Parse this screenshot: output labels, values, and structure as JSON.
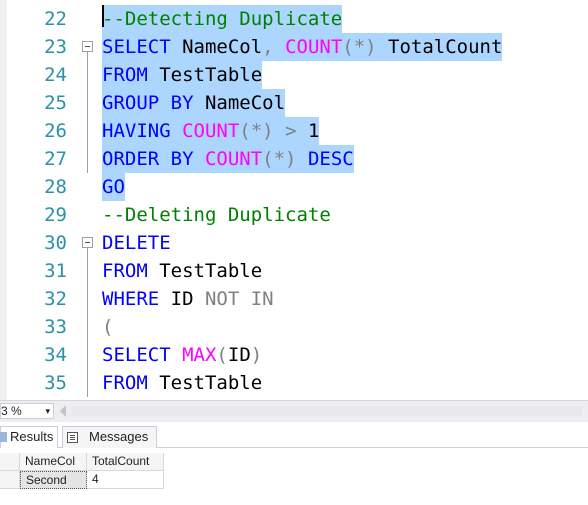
{
  "editor": {
    "lines": [
      {
        "num": "22",
        "sel": true,
        "fold": "",
        "tokens": [
          {
            "t": "--Detecting Duplicate",
            "c": "cm"
          }
        ]
      },
      {
        "num": "23",
        "sel": true,
        "fold": "minus",
        "tokens": [
          {
            "t": "SELECT",
            "c": "kw"
          },
          {
            "t": " NameCol",
            "c": "id"
          },
          {
            "t": ",",
            "c": "op"
          },
          {
            "t": " ",
            "c": "id"
          },
          {
            "t": "COUNT",
            "c": "fn"
          },
          {
            "t": "(*)",
            "c": "op"
          },
          {
            "t": " TotalCount",
            "c": "id"
          }
        ]
      },
      {
        "num": "24",
        "sel": true,
        "fold": "rail",
        "tokens": [
          {
            "t": "FROM",
            "c": "kw"
          },
          {
            "t": " TestTable",
            "c": "id"
          }
        ]
      },
      {
        "num": "25",
        "sel": true,
        "fold": "rail",
        "tokens": [
          {
            "t": "GROUP BY",
            "c": "kw"
          },
          {
            "t": " NameCol",
            "c": "id"
          }
        ]
      },
      {
        "num": "26",
        "sel": true,
        "fold": "rail",
        "tokens": [
          {
            "t": "HAVING",
            "c": "kw"
          },
          {
            "t": " ",
            "c": "id"
          },
          {
            "t": "COUNT",
            "c": "fn"
          },
          {
            "t": "(*)",
            "c": "op"
          },
          {
            "t": " ",
            "c": "id"
          },
          {
            "t": ">",
            "c": "op"
          },
          {
            "t": " 1",
            "c": "id"
          }
        ]
      },
      {
        "num": "27",
        "sel": true,
        "fold": "rail",
        "tokens": [
          {
            "t": "ORDER BY",
            "c": "kw"
          },
          {
            "t": " ",
            "c": "id"
          },
          {
            "t": "COUNT",
            "c": "fn"
          },
          {
            "t": "(*)",
            "c": "op"
          },
          {
            "t": " ",
            "c": "id"
          },
          {
            "t": "DESC",
            "c": "kw"
          }
        ]
      },
      {
        "num": "28",
        "sel": true,
        "fold": "",
        "tokens": [
          {
            "t": "GO",
            "c": "kw"
          }
        ]
      },
      {
        "num": "29",
        "sel": false,
        "fold": "",
        "tokens": [
          {
            "t": "--Deleting Duplicate",
            "c": "cm"
          }
        ]
      },
      {
        "num": "30",
        "sel": false,
        "fold": "minus",
        "tokens": [
          {
            "t": "DELETE",
            "c": "kw"
          }
        ]
      },
      {
        "num": "31",
        "sel": false,
        "fold": "rail",
        "tokens": [
          {
            "t": "FROM",
            "c": "kw"
          },
          {
            "t": " TestTable",
            "c": "id"
          }
        ]
      },
      {
        "num": "32",
        "sel": false,
        "fold": "rail",
        "tokens": [
          {
            "t": "WHERE",
            "c": "kw"
          },
          {
            "t": " ID ",
            "c": "id"
          },
          {
            "t": "NOT IN",
            "c": "op"
          }
        ]
      },
      {
        "num": "33",
        "sel": false,
        "fold": "rail",
        "tokens": [
          {
            "t": "(",
            "c": "op"
          }
        ]
      },
      {
        "num": "34",
        "sel": false,
        "fold": "rail",
        "tokens": [
          {
            "t": "SELECT",
            "c": "kw"
          },
          {
            "t": " ",
            "c": "id"
          },
          {
            "t": "MAX",
            "c": "fn"
          },
          {
            "t": "(",
            "c": "op"
          },
          {
            "t": "ID",
            "c": "id"
          },
          {
            "t": ")",
            "c": "op"
          }
        ]
      },
      {
        "num": "35",
        "sel": false,
        "fold": "rail",
        "tokens": [
          {
            "t": "FROM",
            "c": "kw"
          },
          {
            "t": " TestTable",
            "c": "id"
          }
        ]
      }
    ]
  },
  "status": {
    "zoom_value": "3 %",
    "zoom_caret": "▾"
  },
  "results": {
    "tabs": [
      {
        "label": "Results",
        "active": true
      },
      {
        "label": "Messages",
        "active": false
      }
    ],
    "columns": [
      "NameCol",
      "TotalCount"
    ],
    "rows": [
      [
        "Second",
        "4"
      ]
    ]
  },
  "colors": {
    "keyword": "#0000ff",
    "function": "#ff00ff",
    "comment": "#008000",
    "operator": "#808080",
    "line_number": "#2b91af",
    "selection": "#add6ff"
  }
}
